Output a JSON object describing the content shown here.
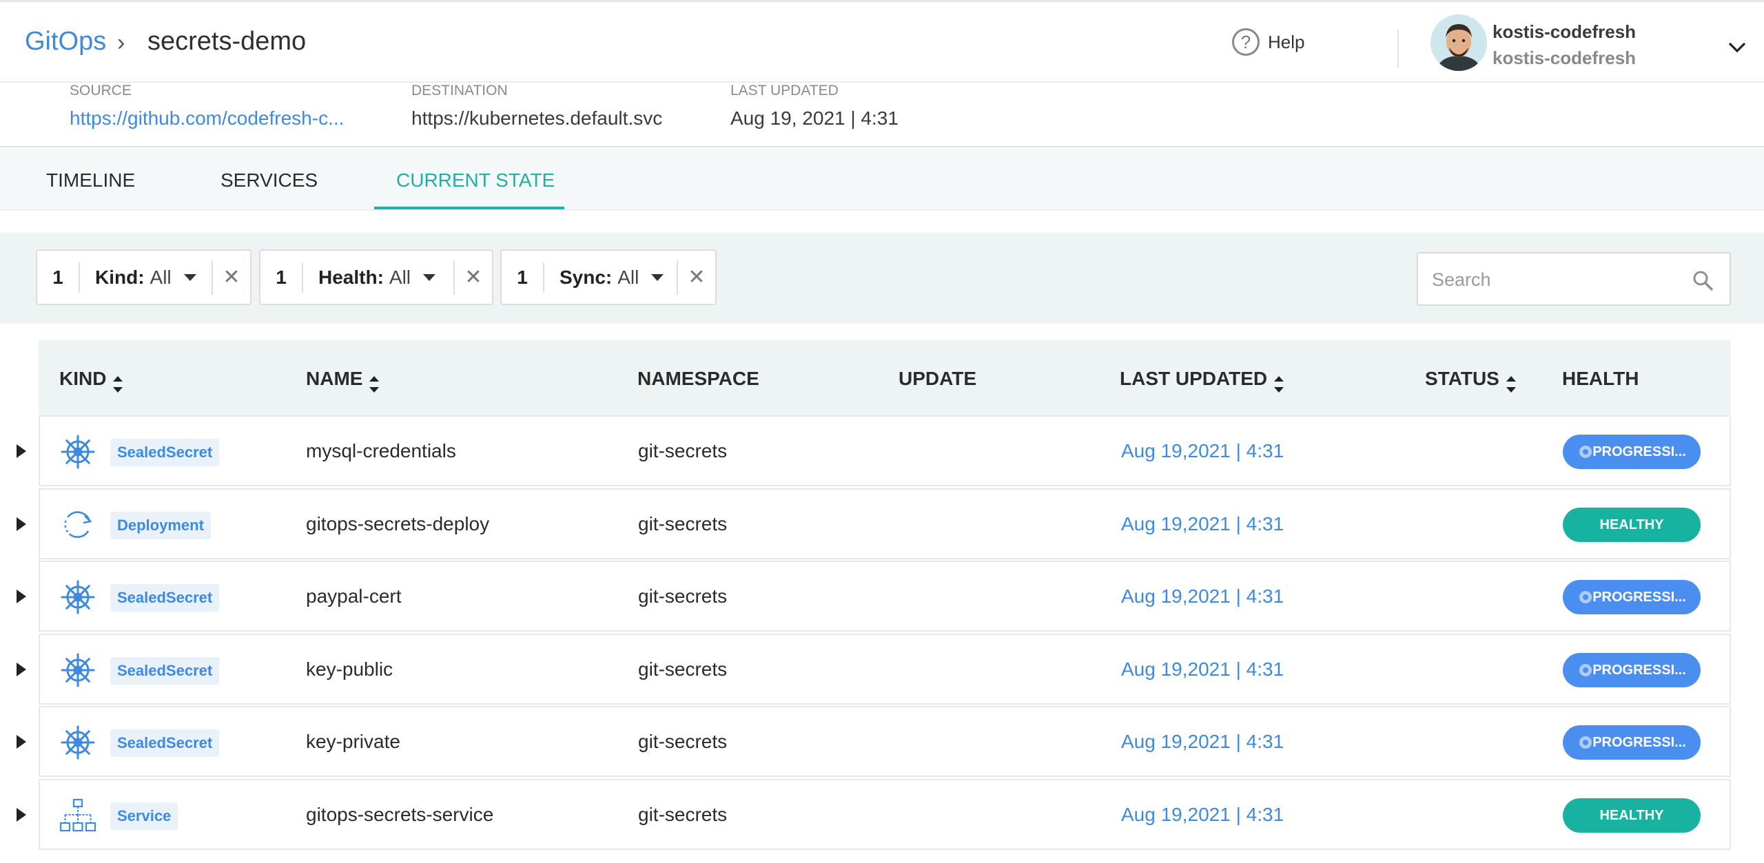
{
  "header": {
    "root": "GitOps",
    "separator": "›",
    "page": "secrets-demo",
    "help_label": "Help",
    "user_name": "kostis-codefresh",
    "user_org": "kostis-codefresh"
  },
  "info": {
    "source_label": "SOURCE",
    "source_value": "https://github.com/codefresh-c...",
    "destination_label": "DESTINATION",
    "destination_value": "https://kubernetes.default.svc",
    "updated_label": "LAST UPDATED",
    "updated_value": "Aug 19, 2021 | 4:31"
  },
  "tabs": [
    {
      "label": "TIMELINE",
      "active": false
    },
    {
      "label": "SERVICES",
      "active": false
    },
    {
      "label": "CURRENT STATE",
      "active": true
    }
  ],
  "filters": [
    {
      "count": "1",
      "label": "Kind:",
      "value": "All"
    },
    {
      "count": "1",
      "label": "Health:",
      "value": "All"
    },
    {
      "count": "1",
      "label": "Sync:",
      "value": "All"
    }
  ],
  "search": {
    "placeholder": "Search"
  },
  "table": {
    "columns": {
      "kind": "KIND",
      "name": "NAME",
      "namespace": "NAMESPACE",
      "update": "UPDATE",
      "last_updated": "LAST UPDATED",
      "status": "STATUS",
      "health": "HEALTH"
    },
    "rows": [
      {
        "kind": "SealedSecret",
        "icon": "helm-wheel-icon",
        "name": "mysql-credentials",
        "namespace": "git-secrets",
        "last_updated": "Aug 19,2021 | 4:31",
        "health": "PROGRESSI...",
        "health_type": "progressing"
      },
      {
        "kind": "Deployment",
        "icon": "deployment-icon",
        "name": "gitops-secrets-deploy",
        "namespace": "git-secrets",
        "last_updated": "Aug 19,2021 | 4:31",
        "health": "HEALTHY",
        "health_type": "healthy"
      },
      {
        "kind": "SealedSecret",
        "icon": "helm-wheel-icon",
        "name": "paypal-cert",
        "namespace": "git-secrets",
        "last_updated": "Aug 19,2021 | 4:31",
        "health": "PROGRESSI...",
        "health_type": "progressing"
      },
      {
        "kind": "SealedSecret",
        "icon": "helm-wheel-icon",
        "name": "key-public",
        "namespace": "git-secrets",
        "last_updated": "Aug 19,2021 | 4:31",
        "health": "PROGRESSI...",
        "health_type": "progressing"
      },
      {
        "kind": "SealedSecret",
        "icon": "helm-wheel-icon",
        "name": "key-private",
        "namespace": "git-secrets",
        "last_updated": "Aug 19,2021 | 4:31",
        "health": "PROGRESSI...",
        "health_type": "progressing"
      },
      {
        "kind": "Service",
        "icon": "service-icon",
        "name": "gitops-secrets-service",
        "namespace": "git-secrets",
        "last_updated": "Aug 19,2021 | 4:31",
        "health": "HEALTHY",
        "health_type": "healthy"
      }
    ]
  },
  "colors": {
    "link": "#3d8ae0",
    "accent": "#1fb3a9",
    "progressing": "#4a8ef0",
    "healthy": "#17b2a0"
  }
}
